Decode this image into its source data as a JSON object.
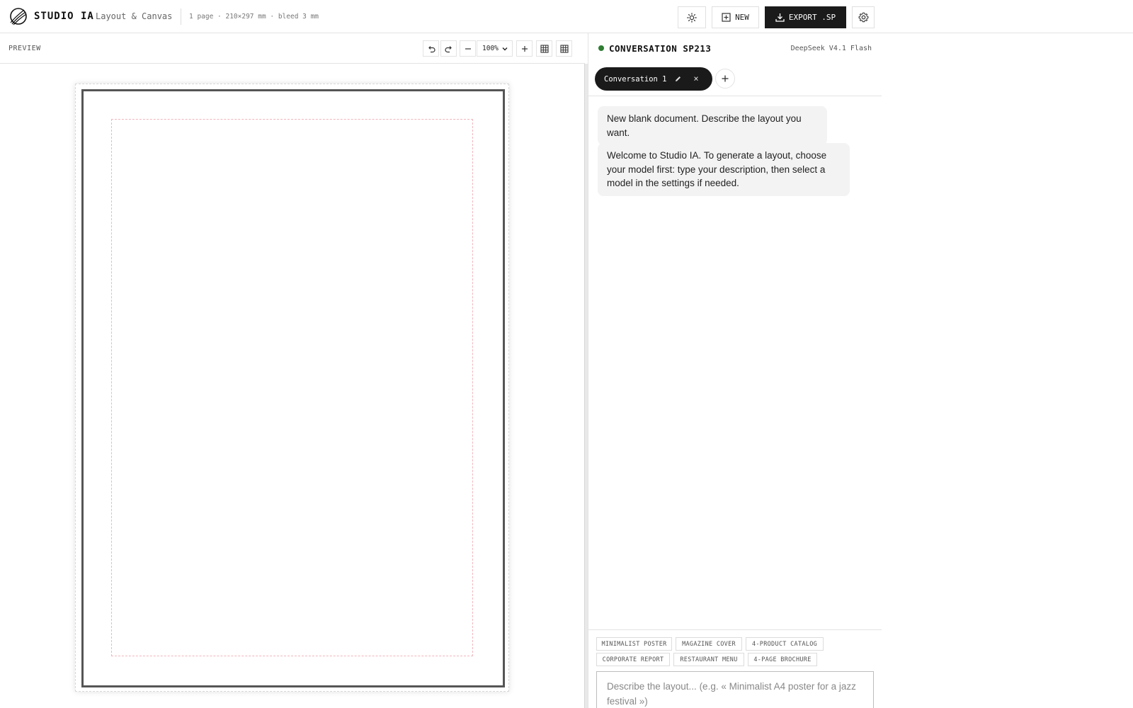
{
  "app": {
    "brand": "STUDIO IA",
    "subtitle": "Layout & Canvas",
    "doc_info": "1 page · 210×297 mm · bleed 3 mm"
  },
  "header": {
    "theme_icon": "sun-icon",
    "new_label": "NEW",
    "export_label": "EXPORT .SP",
    "settings_icon": "gear-icon"
  },
  "preview": {
    "label": "PREVIEW",
    "zoom": "100%",
    "tools": [
      "undo-icon",
      "redo-icon",
      "zoom-out-icon",
      "zoom-in-icon",
      "grid-icon",
      "grid-alt-icon"
    ]
  },
  "panel": {
    "title": "CONVERSATION SP213",
    "model": "DeepSeek V4.1 Flash",
    "status_color": "#2e7d32",
    "tabs": [
      {
        "label": "Conversation 1",
        "active": true
      }
    ],
    "messages": [
      {
        "text": "New blank document. Describe the layout you want."
      },
      {
        "text": "Welcome to Studio IA. To generate a layout, choose your model first: type your description, then select a model in the settings if needed."
      }
    ],
    "suggestions": [
      "MINIMALIST POSTER",
      "MAGAZINE COVER",
      "4-PRODUCT CATALOG",
      "CORPORATE REPORT",
      "RESTAURANT MENU",
      "4-PAGE BROCHURE"
    ],
    "input_placeholder": "Describe the layout... (e.g. « Minimalist A4 poster for a jazz festival »)"
  },
  "colors": {
    "accent_dark": "#1a1a1a",
    "margin_guide": "#f2b5bc",
    "status_green": "#2e7d32"
  }
}
